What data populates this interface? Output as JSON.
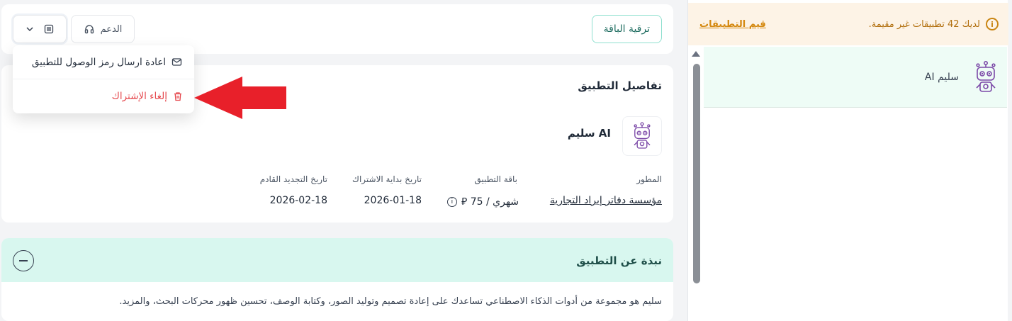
{
  "sidebar": {
    "warning_text": "لديك 42 تطبيقات غير مقيمة.",
    "warning_link": "قيم التطبيقات",
    "apps": [
      {
        "name": "سليم AI"
      }
    ]
  },
  "header": {
    "upgrade_label": "ترقية الباقة",
    "support_label": "الدعم"
  },
  "menu": {
    "items": [
      {
        "label": "اعادة ارسال رمز الوصول للتطبيق",
        "icon": "mail-send-icon"
      },
      {
        "label": "إلغاء الإشتراك",
        "icon": "trash-icon"
      }
    ]
  },
  "details": {
    "title": "تفاصيل التطبيق",
    "app_name": "سليم AI",
    "fields": {
      "developer_label": "المطور",
      "developer_value": "مؤسسة دفاتر إيراد التجارية",
      "plan_label": "باقة التطبيق",
      "plan_value": "شهري / 75 ⃁",
      "start_label": "تاريخ بداية الاشتراك",
      "start_value": "2026-01-18",
      "renew_label": "تاريخ التجديد القادم",
      "renew_value": "2026-02-18"
    }
  },
  "about": {
    "title": "نبذة عن التطبيق",
    "text": "سليم هو مجموعة من أدوات الذكاء الاصطناعي تساعدك على إعادة تصميم وتوليد الصور، وكتابة الوصف، تحسين ظهور محركات البحث، والمزيد."
  },
  "colors": {
    "accent": "#1f6d61",
    "danger": "#e5484d",
    "warning": "#c98512",
    "highlight_arrow": "#e8202a"
  }
}
